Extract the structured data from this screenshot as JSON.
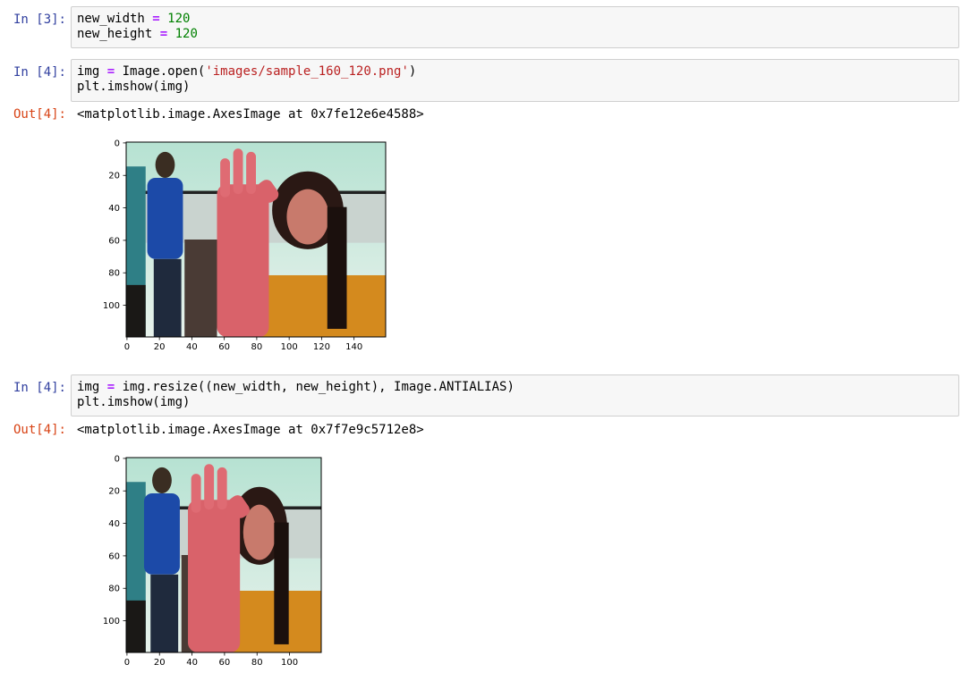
{
  "cells": [
    {
      "prompt": "In [3]:",
      "code_lines": [
        [
          {
            "t": "new_width ",
            "k": "plain"
          },
          {
            "t": "=",
            "k": "op"
          },
          {
            "t": " ",
            "k": "plain"
          },
          {
            "t": "120",
            "k": "num"
          }
        ],
        [
          {
            "t": "new_height ",
            "k": "plain"
          },
          {
            "t": "=",
            "k": "op"
          },
          {
            "t": " ",
            "k": "plain"
          },
          {
            "t": "120",
            "k": "num"
          }
        ]
      ]
    },
    {
      "prompt": "In [4]:",
      "code_lines": [
        [
          {
            "t": "img ",
            "k": "plain"
          },
          {
            "t": "=",
            "k": "op"
          },
          {
            "t": " Image.open(",
            "k": "plain"
          },
          {
            "t": "'images/sample_160_120.png'",
            "k": "str"
          },
          {
            "t": ")",
            "k": "plain"
          }
        ],
        [
          {
            "t": "plt.imshow(img)",
            "k": "plain"
          }
        ]
      ],
      "output_prompt": "Out[4]:",
      "output_text": "<matplotlib.image.AxesImage at 0x7fe12e6e4588>",
      "plot": {
        "image_width": 160,
        "image_height": 120,
        "x_ticks": [
          "0",
          "20",
          "40",
          "60",
          "80",
          "100",
          "120",
          "140"
        ],
        "y_ticks": [
          "0",
          "20",
          "40",
          "60",
          "80",
          "100"
        ]
      }
    },
    {
      "prompt": "In [4]:",
      "code_lines": [
        [
          {
            "t": "img ",
            "k": "plain"
          },
          {
            "t": "=",
            "k": "op"
          },
          {
            "t": " img.resize((new_width, new_height), Image.ANTIALIAS)",
            "k": "plain"
          }
        ],
        [
          {
            "t": "plt.imshow(img)",
            "k": "plain"
          }
        ]
      ],
      "output_prompt": "Out[4]:",
      "output_text": "<matplotlib.image.AxesImage at 0x7f7e9c5712e8>",
      "plot": {
        "image_width": 120,
        "image_height": 120,
        "x_ticks": [
          "0",
          "20",
          "40",
          "60",
          "80",
          "100"
        ],
        "y_ticks": [
          "0",
          "20",
          "40",
          "60",
          "80",
          "100"
        ]
      }
    }
  ],
  "colors": {
    "input_prompt": "#303f9f",
    "output_prompt": "#d84315",
    "operator": "#aa22ff",
    "number": "#008000",
    "string": "#ba2121"
  }
}
